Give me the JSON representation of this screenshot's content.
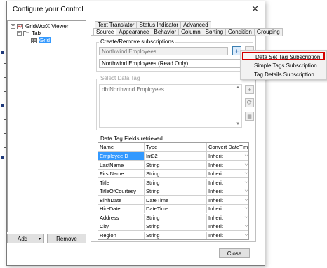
{
  "window": {
    "title": "Configure your Control"
  },
  "tree": [
    {
      "label": "GridWorX Viewer",
      "toggle": "−"
    },
    {
      "label": "Tab",
      "toggle": "−"
    },
    {
      "label": "Grid",
      "toggle": ""
    }
  ],
  "buttons": {
    "add": "Add",
    "add_split": "▾",
    "remove": "Remove",
    "close": "Close"
  },
  "tabs": {
    "top": [
      "Text Translator",
      "Status Indicator",
      "Advanced"
    ],
    "bottom": [
      "Source",
      "Appearance",
      "Behavior",
      "Column",
      "Sorting",
      "Condition",
      "Grouping"
    ],
    "active": "Source"
  },
  "subscriptions": {
    "group_label": "Create/Remove subscriptions",
    "name_field": "Northwind Employees",
    "combo_value": "Northwind Employees (Read Only)"
  },
  "select_tag": {
    "group_label": "Select Data Tag",
    "list_item": "db:Northwind.Employees"
  },
  "fields": {
    "group_label": "Data Tag Fields retrieved",
    "columns": [
      "Name",
      "Type",
      "Convert DateTime"
    ],
    "rows": [
      {
        "name": "EmployeeID",
        "type": "Int32",
        "convert": "Inherit",
        "selected": true
      },
      {
        "name": "LastName",
        "type": "String",
        "convert": "Inherit"
      },
      {
        "name": "FirstName",
        "type": "String",
        "convert": "Inherit"
      },
      {
        "name": "Title",
        "type": "String",
        "convert": "Inherit"
      },
      {
        "name": "TitleOfCourtesy",
        "type": "String",
        "convert": "Inherit"
      },
      {
        "name": "BirthDate",
        "type": "DateTime",
        "convert": "Inherit"
      },
      {
        "name": "HireDate",
        "type": "DateTime",
        "convert": "Inherit"
      },
      {
        "name": "Address",
        "type": "String",
        "convert": "Inherit"
      },
      {
        "name": "City",
        "type": "String",
        "convert": "Inherit"
      },
      {
        "name": "Region",
        "type": "String",
        "convert": "Inherit"
      }
    ]
  },
  "menu": {
    "items": [
      "Data Set Tag Subscription",
      "Simple Tags Subscription",
      "Tag Details Subscription"
    ],
    "highlighted": "Data Set Tag Subscription"
  },
  "colors": {
    "selection": "#3399ff",
    "highlight_border": "#d40000"
  }
}
